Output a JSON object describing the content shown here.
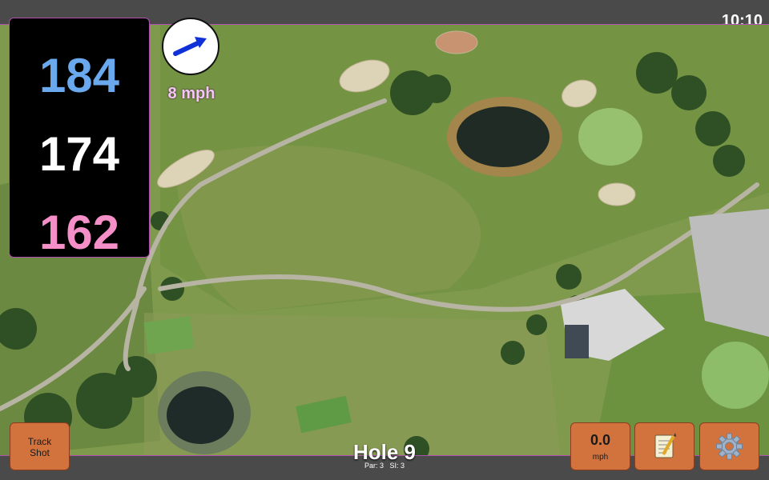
{
  "status": {
    "time": "10:10"
  },
  "distances": {
    "back": "184",
    "middle": "174",
    "front": "162"
  },
  "wind": {
    "label": "8 mph",
    "icon": "wind-arrow-icon"
  },
  "track_button": {
    "line1": "Track",
    "line2": "Shot"
  },
  "speed_button": {
    "value": "0.0",
    "unit": "mph"
  },
  "notes_button": {
    "icon": "notepad-icon"
  },
  "settings_button": {
    "icon": "gear-icon"
  },
  "hole": {
    "title": "Hole 9",
    "par_label": "Par: 3",
    "si_label": "SI: 3"
  },
  "colors": {
    "back": "#6aa9ee",
    "middle": "#ffffff",
    "front": "#f58fc8",
    "button": "#d2733e",
    "accent": "#b04fb0"
  }
}
